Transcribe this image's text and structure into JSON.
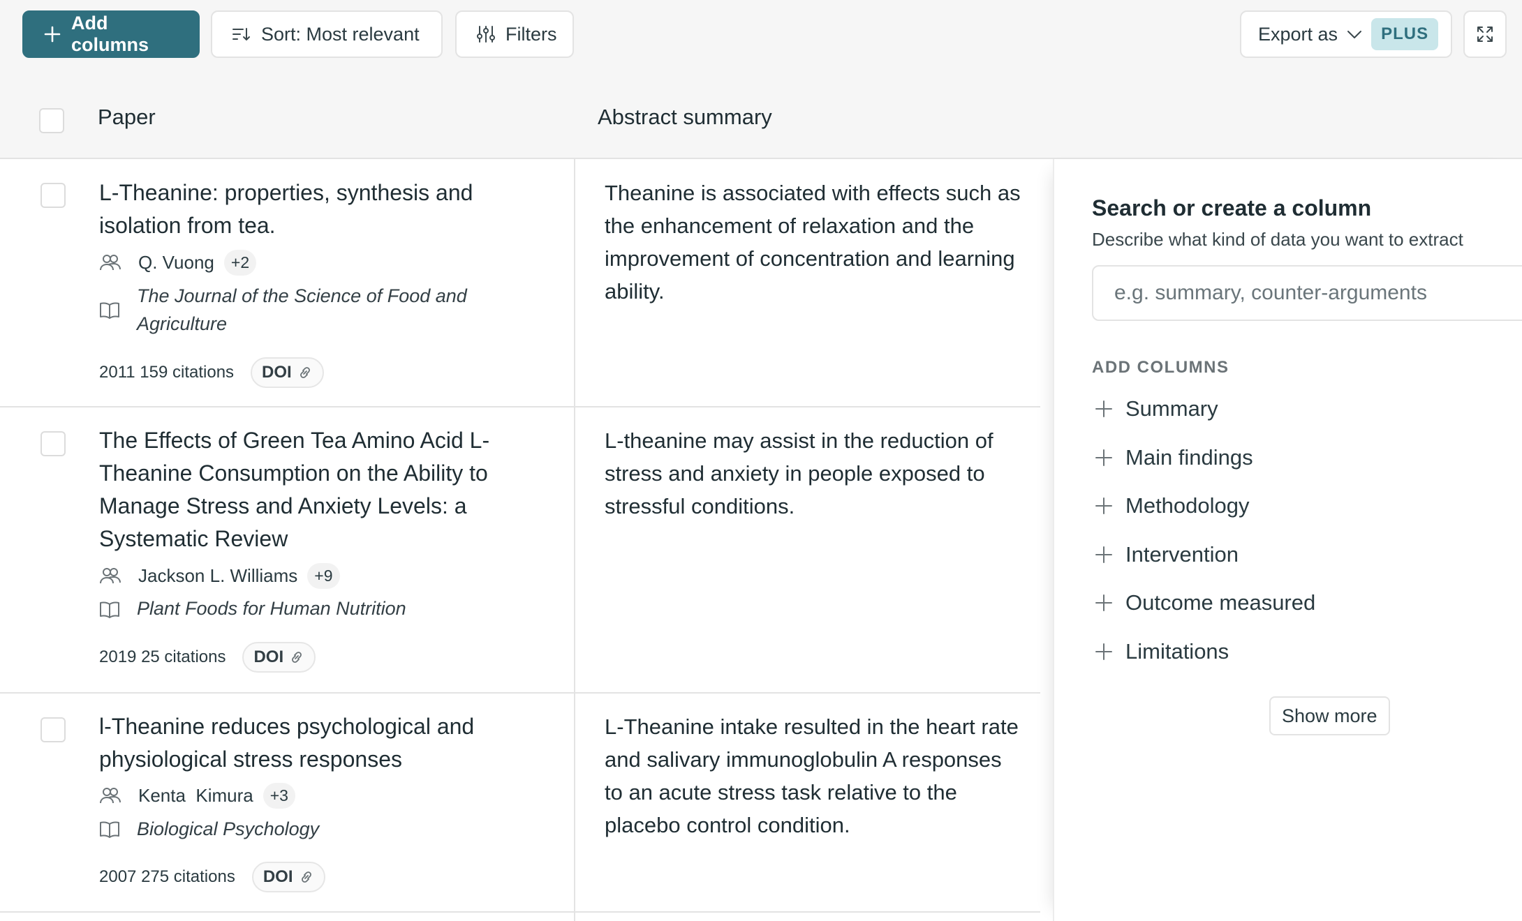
{
  "toolbar": {
    "add_columns": "Add columns",
    "sort": "Sort: Most relevant",
    "filters": "Filters",
    "export": "Export as",
    "plus_badge": "PLUS"
  },
  "table": {
    "headers": {
      "paper": "Paper",
      "abstract": "Abstract summary"
    },
    "rows": [
      {
        "title": "L-Theanine: properties, synthesis and isolation from tea.",
        "author": "Q. Vuong",
        "more_authors": "+2",
        "journal": "The Journal of the Science of Food and Agriculture",
        "year": "2011",
        "citations": "159 citations",
        "doi": "DOI",
        "summary": "Theanine is associated with effects such as the enhancement of relaxation and the improvement of concentration and learning ability."
      },
      {
        "title": "The Effects of Green Tea Amino Acid L-Theanine Consumption on the Ability to Manage Stress and Anxiety Levels: a Systematic Review",
        "author": "Jackson L. Williams",
        "more_authors": "+9",
        "journal": "Plant Foods for Human Nutrition",
        "year": "2019",
        "citations": "25 citations",
        "doi": "DOI",
        "summary": "L-theanine may assist in the reduction of stress and anxiety in people exposed to stressful conditions."
      },
      {
        "title": "l-Theanine reduces psychological and physiological stress responses",
        "author": "Kenta  Kimura",
        "more_authors": "+3",
        "journal": "Biological Psychology",
        "year": "2007",
        "citations": "275 citations",
        "doi": "DOI",
        "summary": "L-Theanine intake resulted in the heart rate and salivary immunoglobulin A responses to an acute stress task relative to the placebo control condition."
      }
    ]
  },
  "panel": {
    "title": "Search or create a column",
    "subtitle": "Describe what kind of data you want to extract",
    "placeholder": "e.g. summary, counter-arguments",
    "section_label": "ADD COLUMNS",
    "options": [
      "Summary",
      "Main findings",
      "Methodology",
      "Intervention",
      "Outcome measured",
      "Limitations"
    ],
    "show_more": "Show more"
  },
  "colors": {
    "primary": "#2f6f7e",
    "plus_badge_bg": "#c9e6ea",
    "toolbar_bg": "#f6f6f6",
    "border": "#e3e3e3"
  }
}
